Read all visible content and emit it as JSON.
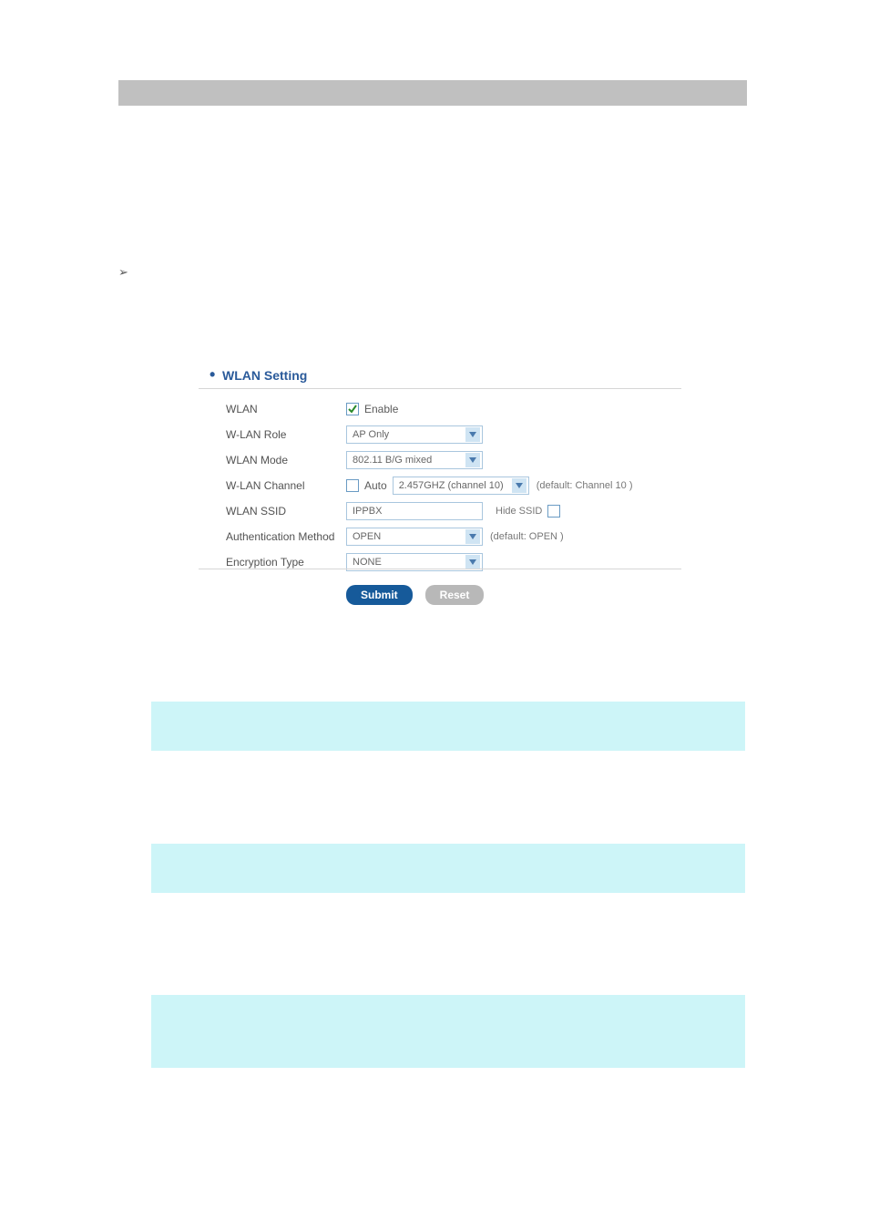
{
  "section_title": "WLAN Setting",
  "fields": {
    "wlan": {
      "label": "WLAN",
      "enable_text": "Enable",
      "enabled": true
    },
    "role": {
      "label": "W-LAN Role",
      "value": "AP Only"
    },
    "mode": {
      "label": "WLAN Mode",
      "value": "802.11 B/G mixed"
    },
    "channel": {
      "label": "W-LAN Channel",
      "auto_text": "Auto",
      "auto_checked": false,
      "value": "2.457GHZ (channel 10)",
      "default_hint": "(default: Channel 10 )"
    },
    "ssid": {
      "label": "WLAN SSID",
      "value": "IPPBX",
      "hide_text": "Hide SSID",
      "hide_checked": false
    },
    "auth": {
      "label": "Authentication Method",
      "value": "OPEN",
      "default_hint": "(default: OPEN )"
    },
    "enc": {
      "label": "Encryption Type",
      "value": "NONE"
    }
  },
  "buttons": {
    "submit": "Submit",
    "reset": "Reset"
  }
}
